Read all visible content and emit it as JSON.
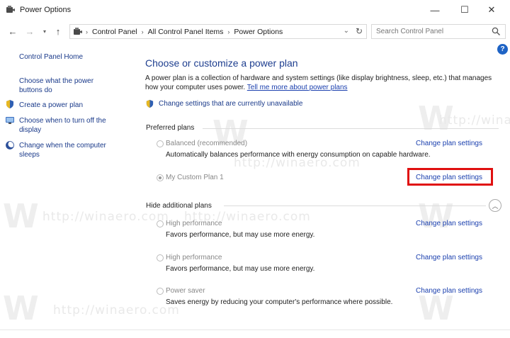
{
  "window": {
    "title": "Power Options",
    "minimize_glyph": "—",
    "maximize_glyph": "☐",
    "close_glyph": "✕"
  },
  "address_bar": {
    "back_glyph": "←",
    "forward_glyph": "→",
    "recent_glyph": "▾",
    "up_glyph": "↑",
    "breadcrumbs": [
      "Control Panel",
      "All Control Panel Items",
      "Power Options"
    ],
    "separator": "›",
    "dropdown_glyph": "⌄",
    "refresh_glyph": "↻"
  },
  "search": {
    "placeholder": "Search Control Panel"
  },
  "sidebar": {
    "home": "Control Panel Home",
    "items": [
      {
        "label": "Choose what the power buttons do",
        "icon": "none"
      },
      {
        "label": "Create a power plan",
        "icon": "shield-icon"
      },
      {
        "label": "Choose when to turn off the display",
        "icon": "monitor-icon"
      },
      {
        "label": "Change when the computer sleeps",
        "icon": "moon-icon"
      }
    ]
  },
  "help": {
    "glyph": "?"
  },
  "main": {
    "title": "Choose or customize a power plan",
    "description": "A power plan is a collection of hardware and system settings (like display brightness, sleep, etc.) that manages how your computer uses power.",
    "tell_me_more": "Tell me more about power plans",
    "unavailable_link": "Change settings that are currently unavailable"
  },
  "preferred_plans": {
    "label": "Preferred plans",
    "plans": [
      {
        "name": "Balanced (recommended)",
        "description": "Automatically balances performance with energy consumption on capable hardware.",
        "link": "Change plan settings",
        "selected": false
      },
      {
        "name": "My Custom Plan 1",
        "description": "",
        "link": "Change plan settings",
        "selected": true
      }
    ]
  },
  "additional_plans": {
    "label": "Hide additional plans",
    "collapse_glyph": "︿",
    "plans": [
      {
        "name": "High performance",
        "description": "Favors performance, but may use more energy.",
        "link": "Change plan settings",
        "selected": false
      },
      {
        "name": "High performance",
        "description": "Favors performance, but may use more energy.",
        "link": "Change plan settings",
        "selected": false
      },
      {
        "name": "Power saver",
        "description": "Saves energy by reducing your computer's performance where possible.",
        "link": "Change plan settings",
        "selected": false
      }
    ]
  },
  "watermark": {
    "url": "http://winaero.com",
    "logo": "W"
  },
  "colors": {
    "link": "#1a3fae",
    "title": "#1e3e8f",
    "highlight": "#e01010"
  }
}
